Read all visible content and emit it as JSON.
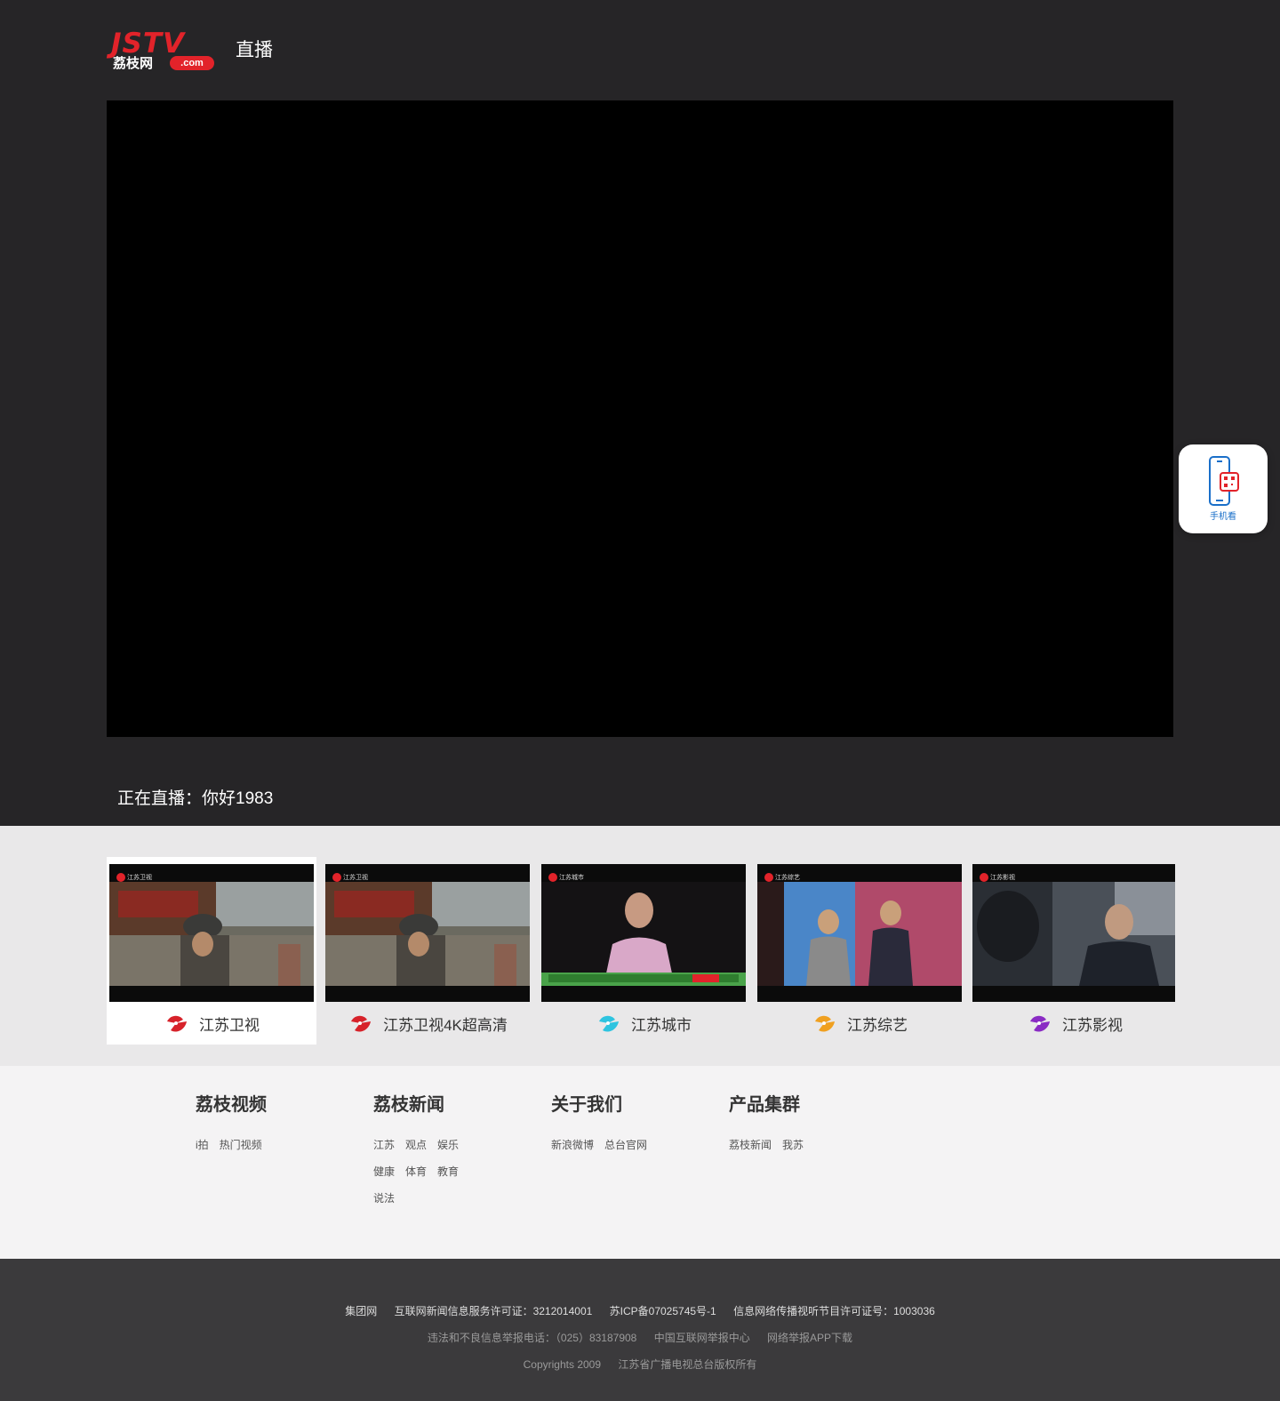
{
  "header": {
    "logo_text": "JSTV",
    "logo_cn": "荔枝网",
    "logo_domain": ".com",
    "title": "直播"
  },
  "side_button": {
    "label": "手机看",
    "icon": "phone-qr-icon"
  },
  "now_playing": {
    "label": "正在直播：",
    "program": "你好1983"
  },
  "channels": [
    {
      "name": "江苏卫视",
      "icon_color": "#d7222a",
      "active": true,
      "thumb_mark": "江苏卫视"
    },
    {
      "name": "江苏卫视4K超高清",
      "icon_color": "#d7222a",
      "active": false,
      "thumb_mark": "江苏卫视"
    },
    {
      "name": "江苏城市",
      "icon_color": "#2ec4e0",
      "active": false,
      "thumb_mark": "江苏城市"
    },
    {
      "name": "江苏综艺",
      "icon_color": "#f0a020",
      "active": false,
      "thumb_mark": "江苏综艺"
    },
    {
      "name": "江苏影视",
      "icon_color": "#8a2bc4",
      "active": false,
      "thumb_mark": "江苏影视"
    }
  ],
  "footer_columns": [
    {
      "title": "荔枝视频",
      "links": [
        "i拍",
        "热门视频"
      ]
    },
    {
      "title": "荔枝新闻",
      "links": [
        "江苏",
        "观点",
        "娱乐",
        "健康",
        "体育",
        "教育",
        "说法"
      ]
    },
    {
      "title": "关于我们",
      "links": [
        "新浪微博",
        "总台官网"
      ]
    },
    {
      "title": "产品集群",
      "links": [
        "荔枝新闻",
        "我苏"
      ]
    }
  ],
  "bottom": {
    "row1": [
      "集团网",
      "互联网新闻信息服务许可证：3212014001",
      "苏ICP备07025745号-1",
      "信息网络传播视听节目许可证号：1003036"
    ],
    "row2": [
      "违法和不良信息举报电话：（025）83187908",
      "中国互联网举报中心",
      "网络举报APP下载"
    ],
    "row3": [
      "Copyrights 2009",
      "江苏省广播电视总台版权所有"
    ]
  },
  "colors": {
    "top_bg": "#262527",
    "accent": "#e2232a",
    "player_bg": "#000000",
    "bottom_bg": "#3b3a3c"
  }
}
